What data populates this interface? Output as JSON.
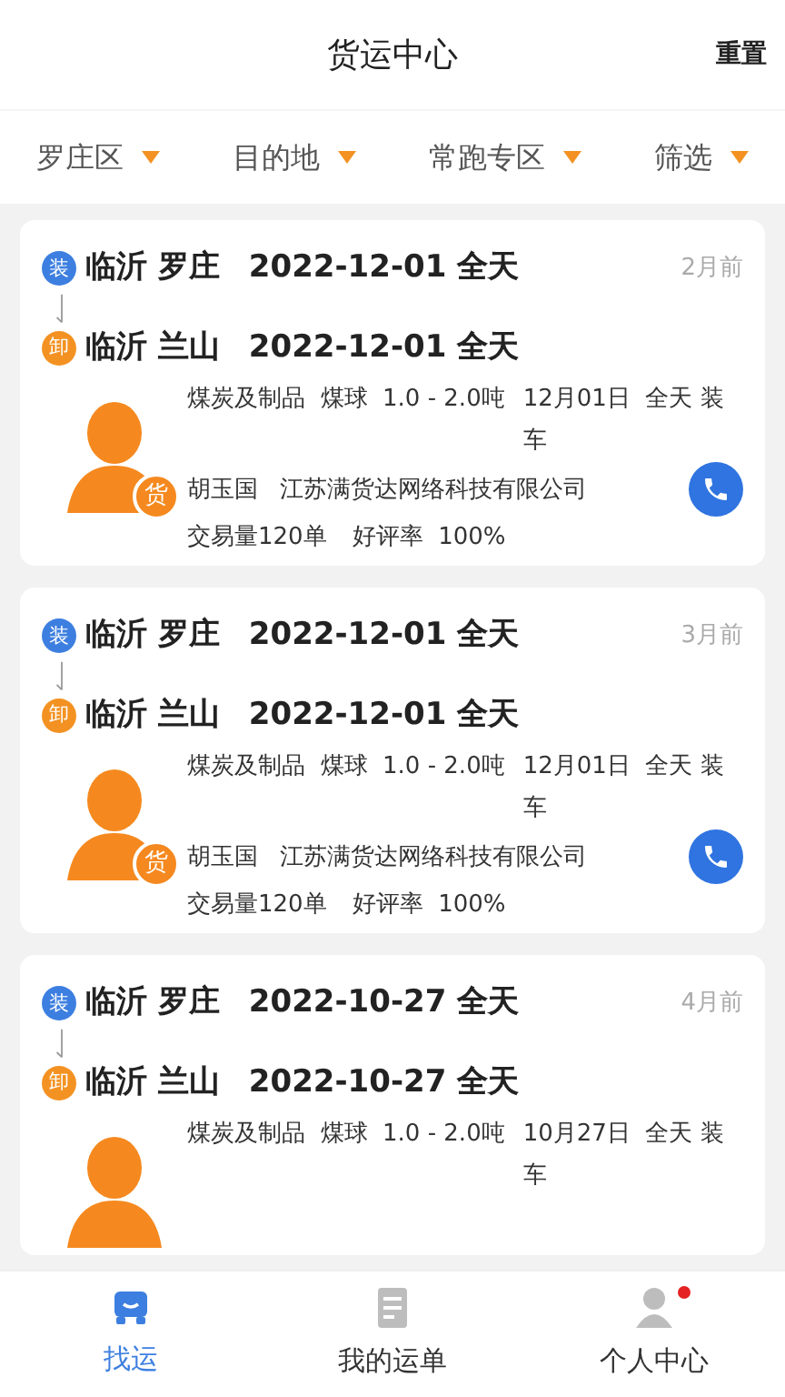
{
  "header": {
    "title": "货运中心",
    "action": "重置"
  },
  "filters": [
    {
      "label": "罗庄区"
    },
    {
      "label": "目的地"
    },
    {
      "label": "常跑专区"
    },
    {
      "label": "筛选"
    }
  ],
  "cards": [
    {
      "load": {
        "badge": "装",
        "place": "临沂 罗庄",
        "time": "2022-12-01 全天"
      },
      "unload": {
        "badge": "卸",
        "place": "临沂 兰山",
        "time": "2022-12-01 全天"
      },
      "age": "2月前",
      "goods": "煤炭及制品  煤球  1.0 - 2.0吨",
      "schedule": "12月01日  全天 装车",
      "shipper_badge": "货",
      "contact": {
        "name": "胡玉国",
        "company": "江苏满货达网络科技有限公司"
      },
      "stats": {
        "orders": "交易量120单",
        "rating": "好评率  100%"
      }
    },
    {
      "load": {
        "badge": "装",
        "place": "临沂 罗庄",
        "time": "2022-12-01 全天"
      },
      "unload": {
        "badge": "卸",
        "place": "临沂 兰山",
        "time": "2022-12-01 全天"
      },
      "age": "3月前",
      "goods": "煤炭及制品  煤球  1.0 - 2.0吨",
      "schedule": "12月01日  全天 装车",
      "shipper_badge": "货",
      "contact": {
        "name": "胡玉国",
        "company": "江苏满货达网络科技有限公司"
      },
      "stats": {
        "orders": "交易量120单",
        "rating": "好评率  100%"
      }
    },
    {
      "load": {
        "badge": "装",
        "place": "临沂 罗庄",
        "time": "2022-10-27 全天"
      },
      "unload": {
        "badge": "卸",
        "place": "临沂 兰山",
        "time": "2022-10-27 全天"
      },
      "age": "4月前",
      "goods": "煤炭及制品  煤球  1.0 - 2.0吨",
      "schedule": "10月27日  全天 装车"
    }
  ],
  "tabs": [
    {
      "kind": "truck",
      "label": "找运",
      "selected": true,
      "dot": false
    },
    {
      "kind": "doc",
      "label": "我的运单",
      "selected": false,
      "dot": false
    },
    {
      "kind": "person",
      "label": "个人中心",
      "selected": false,
      "dot": true
    }
  ]
}
